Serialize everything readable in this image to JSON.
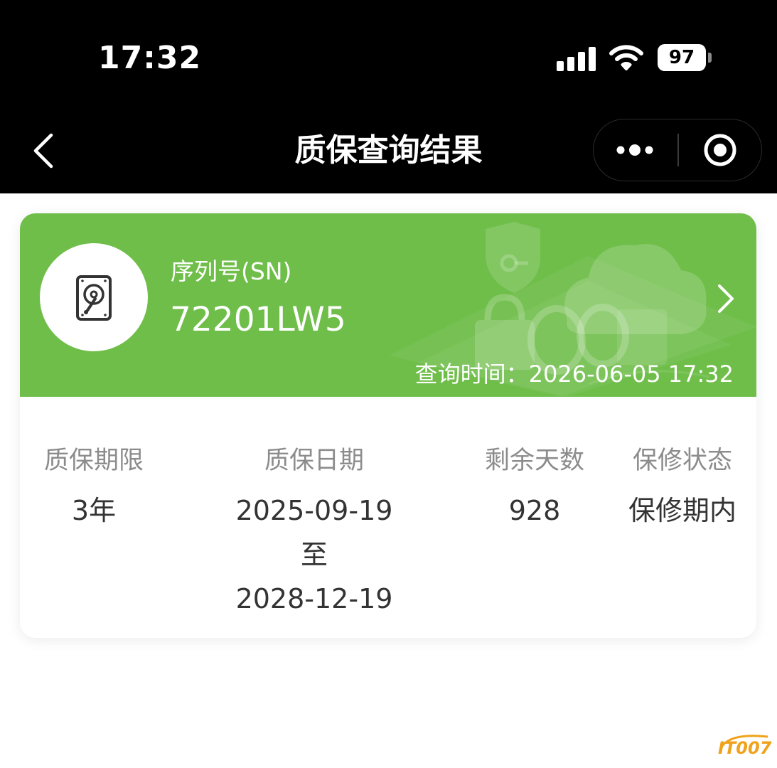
{
  "status_bar": {
    "time": "17:32",
    "battery": "97",
    "icons": [
      "cellular-signal-icon",
      "wifi-icon",
      "battery-icon"
    ]
  },
  "nav": {
    "title": "质保查询结果",
    "back_icon": "chevron-left-icon",
    "more_icon": "more-dots-icon",
    "close_icon": "target-close-icon"
  },
  "card": {
    "sn_label": "序列号(SN)",
    "sn_value": "72201LW5",
    "query_time": "查询时间：2026-06-05 17:32",
    "disk_icon": "hard-disk-icon",
    "chevron_icon": "chevron-right-icon",
    "accent_color": "#6fbe4a"
  },
  "info": {
    "warranty_term": {
      "label": "质保期限",
      "value": "3年"
    },
    "warranty_date": {
      "label": "质保日期",
      "start": "2025-09-19",
      "sep": "至",
      "end": "2028-12-19"
    },
    "remaining_days": {
      "label": "剩余天数",
      "value": "928"
    },
    "repair_status": {
      "label": "保修状态",
      "value": "保修期内"
    }
  },
  "watermark": {
    "text": "IT007"
  }
}
